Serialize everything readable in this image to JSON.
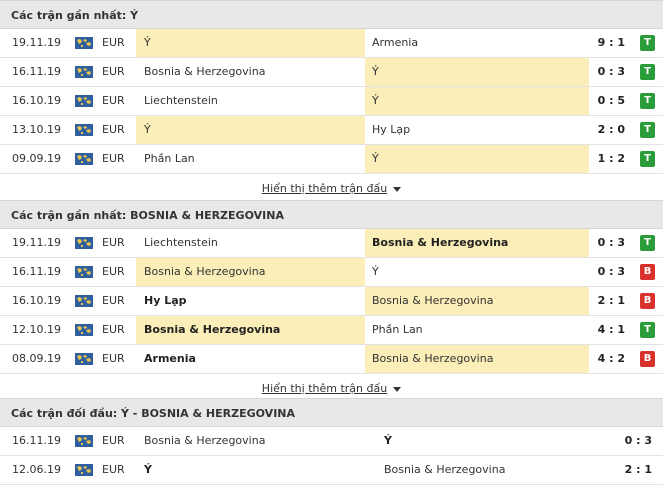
{
  "colors": {
    "win": "#2a9d3a",
    "loss": "#d9322c",
    "highlight": "#fbeeb8",
    "header_bg": "#e8e8e8"
  },
  "icons": {
    "competition": "world-map-icon",
    "more": "chevron-down-icon"
  },
  "sections": [
    {
      "title": "Các trận gần nhất: Ý",
      "more_label": "Hiển thị thêm trận đấu",
      "rows": [
        {
          "date": "19.11.19",
          "comp": "EUR",
          "home": "Ý",
          "away": "Armenia",
          "score": "9 : 1",
          "result": "T",
          "hl": "home",
          "bold": "none"
        },
        {
          "date": "16.11.19",
          "comp": "EUR",
          "home": "Bosnia & Herzegovina",
          "away": "Ý",
          "score": "0 : 3",
          "result": "T",
          "hl": "away",
          "bold": "none"
        },
        {
          "date": "16.10.19",
          "comp": "EUR",
          "home": "Liechtenstein",
          "away": "Ý",
          "score": "0 : 5",
          "result": "T",
          "hl": "away",
          "bold": "none"
        },
        {
          "date": "13.10.19",
          "comp": "EUR",
          "home": "Ý",
          "away": "Hy Lạp",
          "score": "2 : 0",
          "result": "T",
          "hl": "home",
          "bold": "none"
        },
        {
          "date": "09.09.19",
          "comp": "EUR",
          "home": "Phần Lan",
          "away": "Ý",
          "score": "1 : 2",
          "result": "T",
          "hl": "away",
          "bold": "none"
        }
      ]
    },
    {
      "title": "Các trận gần nhất: BOSNIA & HERZEGOVINA",
      "more_label": "Hiển thị thêm trận đấu",
      "rows": [
        {
          "date": "19.11.19",
          "comp": "EUR",
          "home": "Liechtenstein",
          "away": "Bosnia & Herzegovina",
          "score": "0 : 3",
          "result": "T",
          "hl": "away",
          "bold": "away"
        },
        {
          "date": "16.11.19",
          "comp": "EUR",
          "home": "Bosnia & Herzegovina",
          "away": "Ý",
          "score": "0 : 3",
          "result": "B",
          "hl": "home",
          "bold": "none"
        },
        {
          "date": "16.10.19",
          "comp": "EUR",
          "home": "Hy Lạp",
          "away": "Bosnia & Herzegovina",
          "score": "2 : 1",
          "result": "B",
          "hl": "away",
          "bold": "home"
        },
        {
          "date": "12.10.19",
          "comp": "EUR",
          "home": "Bosnia & Herzegovina",
          "away": "Phần Lan",
          "score": "4 : 1",
          "result": "T",
          "hl": "home",
          "bold": "home"
        },
        {
          "date": "08.09.19",
          "comp": "EUR",
          "home": "Armenia",
          "away": "Bosnia & Herzegovina",
          "score": "4 : 2",
          "result": "B",
          "hl": "away",
          "bold": "home"
        }
      ]
    },
    {
      "title": "Các trận đối đầu: Ý - BOSNIA & HERZEGOVINA",
      "rows": [
        {
          "date": "16.11.19",
          "comp": "EUR",
          "home": "Bosnia & Herzegovina",
          "away": "Ý",
          "score": "0 : 3",
          "bold": "away"
        },
        {
          "date": "12.06.19",
          "comp": "EUR",
          "home": "Ý",
          "away": "Bosnia & Herzegovina",
          "score": "2 : 1",
          "bold": "home"
        }
      ]
    }
  ]
}
